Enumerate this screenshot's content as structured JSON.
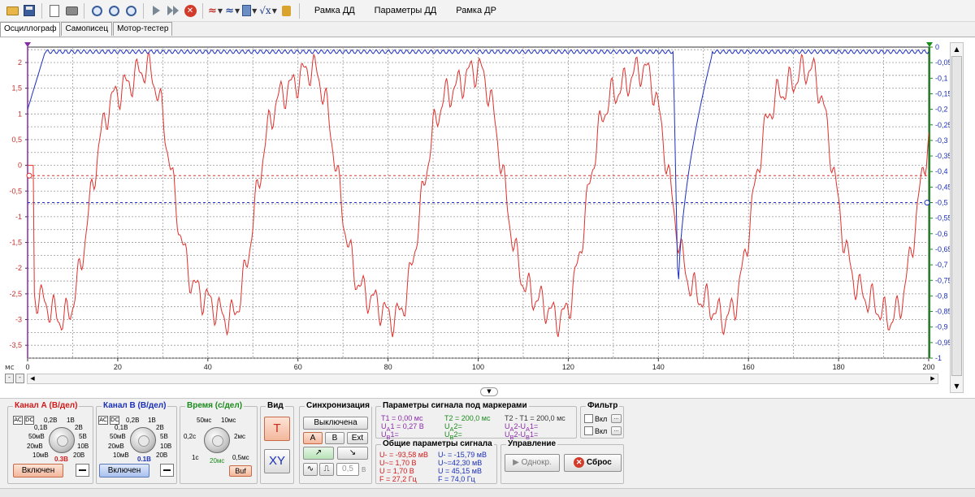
{
  "toolbar": {
    "items": [
      "open-icon",
      "save-icon",
      "print-preview-icon",
      "print-icon",
      "zoom-in-icon",
      "zoom-fit-icon",
      "zoom-settings-icon",
      "play-icon",
      "fast-forward-icon",
      "stop-icon",
      "channel-a-wave-icon",
      "channel-b-wave-icon",
      "calculator-icon",
      "math-sqrt-icon",
      "speaker-icon"
    ],
    "text_buttons": [
      "Рамка ДД",
      "Параметры ДД",
      "Рамка ДР"
    ]
  },
  "tabs": [
    {
      "label": "Осциллограф",
      "active": true
    },
    {
      "label": "Самописец",
      "active": false
    },
    {
      "label": "Мотор-тестер",
      "active": false
    }
  ],
  "plot": {
    "colors": {
      "channel_a": "#e0302c",
      "channel_b": "#1c2fc0",
      "grid": "#9a9a9a",
      "axis_right": "#1a8a1a",
      "marker_left": "#8a2aa8"
    },
    "left_axis_ticks": [
      "2",
      "1,5",
      "1",
      "0,5",
      "0",
      "-0,5",
      "-1",
      "-1,5",
      "-2",
      "-2,5",
      "-3",
      "-3,5"
    ],
    "right_axis_ticks": [
      "0",
      "-0,05",
      "-0,1",
      "-0,15",
      "-0,2",
      "-0,25",
      "-0,3",
      "-0,35",
      "-0,4",
      "-0,45",
      "-0,5",
      "-0,55",
      "-0,6",
      "-0,65",
      "-0,7",
      "-0,75",
      "-0,8",
      "-0,85",
      "-0,9",
      "-0,95",
      "-1"
    ],
    "x_ticks": [
      "0",
      "20",
      "40",
      "60",
      "80",
      "100",
      "120",
      "140",
      "160",
      "180",
      "200"
    ],
    "x_unit": "мс",
    "x_range": [
      0,
      200
    ],
    "y_left_range": [
      -3.75,
      2.3
    ],
    "y_right_range": [
      -1.0,
      0.0
    ],
    "channel_a_level": -0.2,
    "channel_b_level": -0.5
  },
  "panels": {
    "channel_a": {
      "title": "Канал А (В/дел)",
      "modes": [
        "AC",
        "DC"
      ],
      "scale_labels": [
        "0,2В",
        "1В",
        "0,1В",
        "2В",
        "50мВ",
        "5В",
        "20мВ",
        "10В",
        "10мВ",
        "20В"
      ],
      "selected": "0.3В",
      "state_button": "Включен"
    },
    "channel_b": {
      "title": "Канал В (В/дел)",
      "modes": [
        "AC",
        "DC"
      ],
      "scale_labels": [
        "0,2В",
        "1В",
        "0,1В",
        "2В",
        "50мВ",
        "5В",
        "20мВ",
        "10В",
        "10мВ",
        "20В"
      ],
      "selected": "0.1В",
      "state_button": "Включен"
    },
    "time": {
      "title": "Время (с/дел)",
      "scale_labels": [
        "50мс",
        "10мс",
        "0,2с",
        "2мс",
        "1с",
        "0,5мс"
      ],
      "selected": "20мс",
      "buf_button": "Buf"
    },
    "view": {
      "title": "Вид",
      "t_button": "T",
      "xy_button": "XY"
    },
    "sync": {
      "title": "Синхронизация",
      "state_button": "Выключена",
      "sources": [
        "A",
        "B",
        "Ext"
      ],
      "level_value": "0,5",
      "level_unit": "В"
    },
    "markers": {
      "title": "Параметры сигнала под маркерами",
      "t1": "T1 = 0,00 мс",
      "ua1": "0,27 В",
      "ub1": "",
      "t2": "T2 = 200,0 мс",
      "ua2": "",
      "ub2": "",
      "dt": "T2 - T1 = 200,0 мс",
      "dua": "",
      "dub": ""
    },
    "filter": {
      "title": "Фильтр",
      "items": [
        "Вкл",
        "Вкл"
      ]
    },
    "general": {
      "title": "Общие параметры сигнала",
      "a": {
        "u_minus": "U- = -93,58 мВ",
        "u_tilde": "U~= 1,70 В",
        "u": "U = 1,70 В",
        "f": "F = 27,2 Гц"
      },
      "b": {
        "u_minus": "U- = -15,79 мВ",
        "u_tilde": "U~=42,30 мВ",
        "u": "U = 45,15 мВ",
        "f": "F = 74,0 Гц"
      }
    },
    "control": {
      "title": "Управление",
      "single_button": "Однокр.",
      "reset_button": "Сброс"
    }
  }
}
